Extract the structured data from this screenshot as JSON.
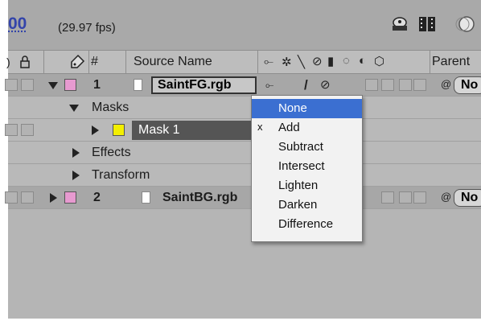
{
  "timecode": "00",
  "fps": "(29.97 fps)",
  "columns": {
    "hash": "#",
    "source_name": "Source Name",
    "parent": "Parent"
  },
  "layers": [
    {
      "number": "1",
      "name": "SaintFG.rgb",
      "label_color": "#e79ad0",
      "parent_value": "No"
    },
    {
      "number": "2",
      "name": "SaintBG.rgb",
      "label_color": "#e79ad0",
      "parent_value": "No"
    }
  ],
  "groups": {
    "masks": "Masks",
    "mask1": "Mask 1",
    "mask1_color": "#f3ef00",
    "effects": "Effects",
    "transform": "Transform"
  },
  "mask_mode_menu": {
    "items": [
      "None",
      "Add",
      "Subtract",
      "Intersect",
      "Lighten",
      "Darken",
      "Difference"
    ],
    "highlighted": "None",
    "checked": "Add",
    "check_mark": "x"
  },
  "colors": {
    "highlight": "#3b6fd1",
    "timecode": "#3344aa"
  }
}
